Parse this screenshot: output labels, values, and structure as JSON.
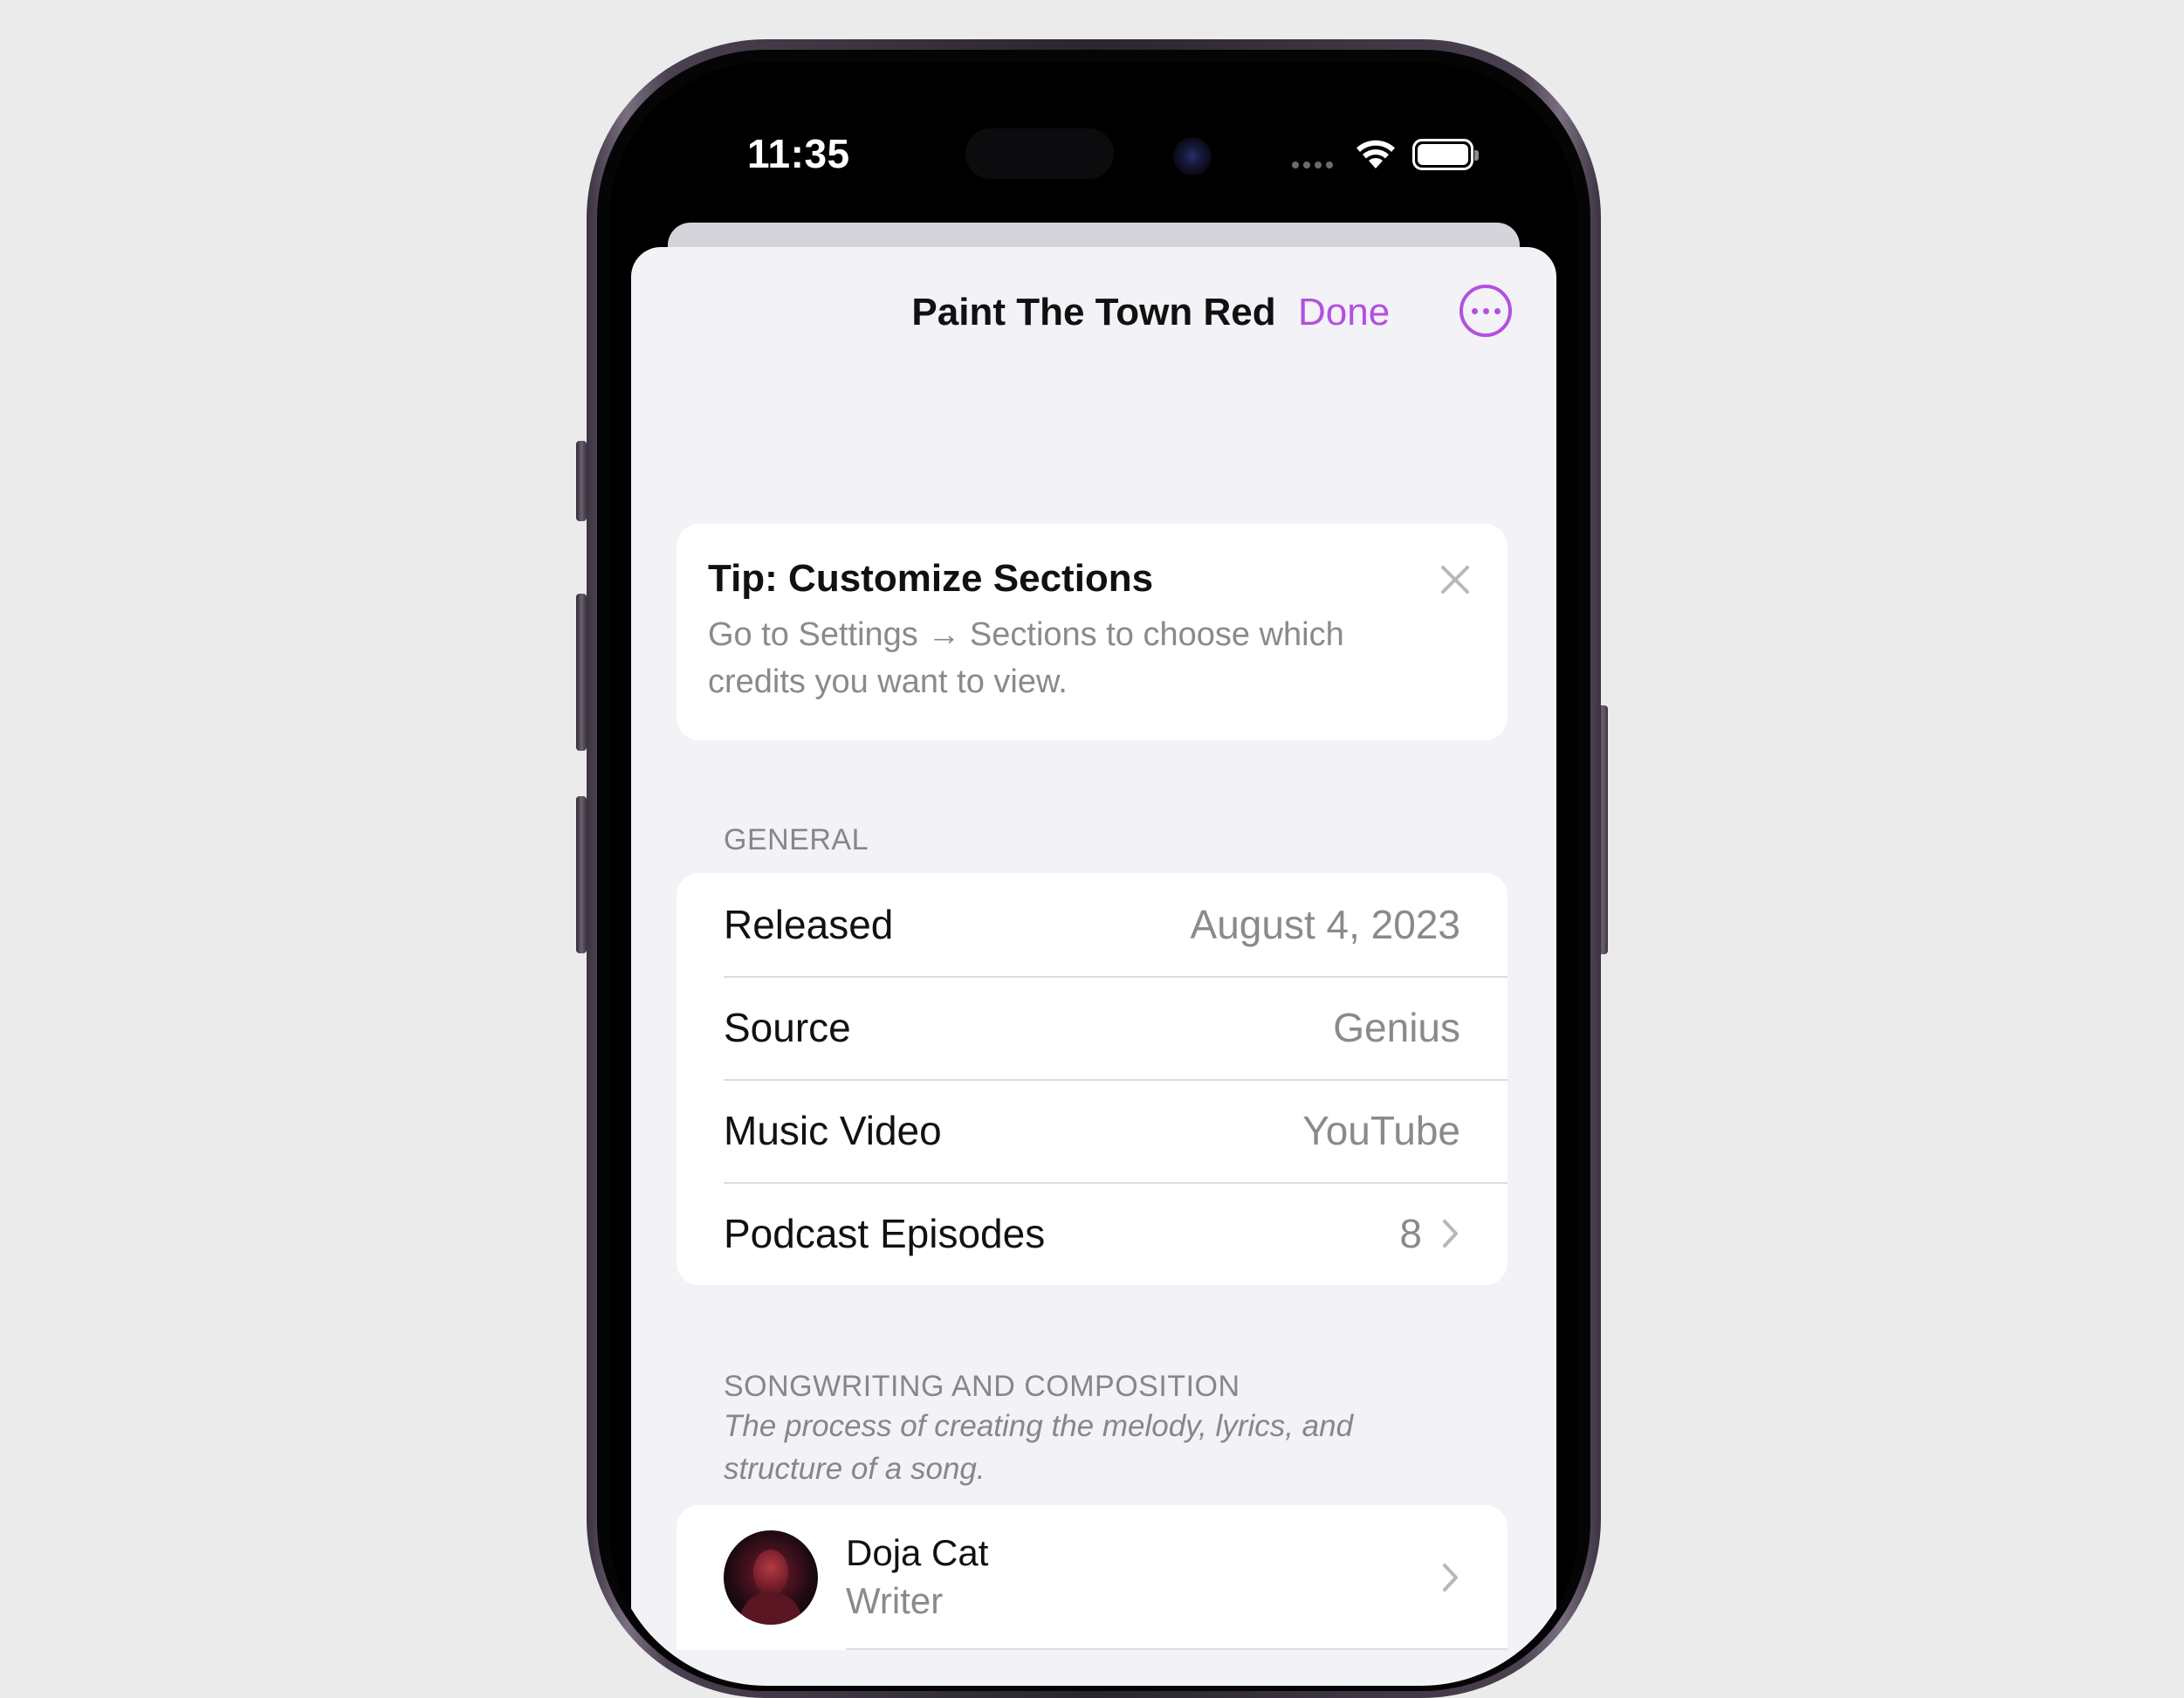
{
  "status_bar": {
    "time": "11:35"
  },
  "nav": {
    "title": "Paint The Town Red",
    "done_label": "Done",
    "more_icon": "ellipsis-circle-icon"
  },
  "tip": {
    "title": "Tip: Customize Sections",
    "body": "Go to Settings → Sections to choose which credits you want to view.",
    "close_icon": "close-icon"
  },
  "general": {
    "header": "GENERAL",
    "rows": [
      {
        "label": "Released",
        "value": "August 4, 2023"
      },
      {
        "label": "Source",
        "value": "Genius"
      },
      {
        "label": "Music Video",
        "value": "YouTube"
      },
      {
        "label": "Podcast Episodes",
        "value": "8"
      }
    ]
  },
  "songwriting": {
    "header": "SONGWRITING AND COMPOSITION",
    "description": "The process of creating the melody, lyrics, and structure of a song.",
    "people": [
      {
        "name": "Doja Cat",
        "role": "Writer"
      }
    ]
  },
  "colors": {
    "accent": "#b44fe0",
    "background": "#f2f2f7",
    "secondary_text": "#8a8a8e"
  }
}
